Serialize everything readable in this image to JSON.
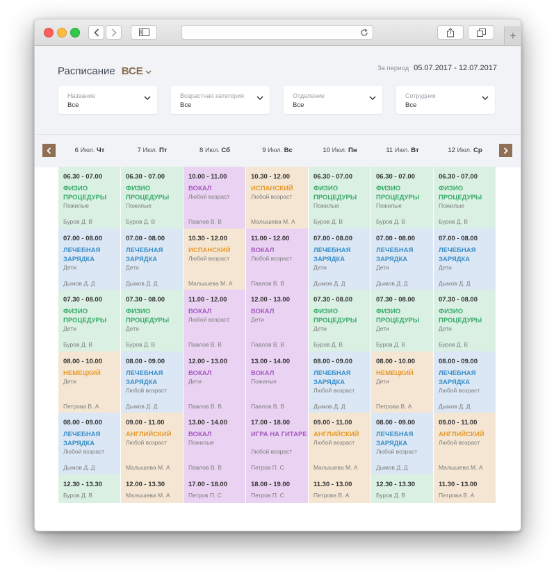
{
  "header": {
    "title": "Расписание",
    "selector": "ВСЕ",
    "period_label": "За период",
    "period_value": "05.07.2017 - 12.07.2017"
  },
  "filters": [
    {
      "label": "Название",
      "value": "Все"
    },
    {
      "label": "Возрастная категория",
      "value": "Все"
    },
    {
      "label": "Отделение",
      "value": "Все"
    },
    {
      "label": "Сотрудник",
      "value": "Все"
    }
  ],
  "colors": {
    "green": "#d9f0e3",
    "blue": "#dbe7f4",
    "pink": "#ead2f2",
    "orange": "#f5e6d3",
    "green_text": "#3aaa6a",
    "blue_text": "#3a8fc9",
    "pink_text": "#a55bc0",
    "orange_text": "#e69a2d",
    "accent": "#8f6f55"
  },
  "days": [
    {
      "num": "6",
      "mon": "Июл.",
      "wd": "Чт"
    },
    {
      "num": "7",
      "mon": "Июл.",
      "wd": "Пт"
    },
    {
      "num": "8",
      "mon": "Июл.",
      "wd": "Сб"
    },
    {
      "num": "9",
      "mon": "Июл.",
      "wd": "Вс"
    },
    {
      "num": "10",
      "mon": "Июл.",
      "wd": "Пн"
    },
    {
      "num": "11",
      "mon": "Июл.",
      "wd": "Вт"
    },
    {
      "num": "12",
      "mon": "Июл.",
      "wd": "Ср"
    }
  ],
  "schedule": [
    [
      {
        "time": "06.30 - 07.00",
        "name": "ФИЗИО ПРОЦЕДУРЫ",
        "age": "Пожилые",
        "teacher": "Буров Д. В",
        "color": "green"
      },
      {
        "time": "07.00 - 08.00",
        "name": "ЛЕЧЕБНАЯ ЗАРЯДКА",
        "age": "Дети",
        "teacher": "Дымов Д. Д",
        "color": "blue"
      },
      {
        "time": "07.30 - 08.00",
        "name": "ФИЗИО ПРОЦЕДУРЫ",
        "age": "Дети",
        "teacher": "Буров Д. В",
        "color": "green"
      },
      {
        "time": "08.00 - 10.00",
        "name": "НЕМЕЦКИЙ",
        "age": "Дети",
        "teacher": "Петрова В. А",
        "color": "orange"
      },
      {
        "time": "08.00 - 09.00",
        "name": "ЛЕЧЕБНАЯ ЗАРЯДКА",
        "age": "Любой возраст",
        "teacher": "Дымов Д. Д",
        "color": "blue"
      },
      {
        "time": "12.30 - 13.30",
        "name": "",
        "age": "",
        "teacher": "Буров Д. В",
        "color": "green"
      }
    ],
    [
      {
        "time": "06.30 - 07.00",
        "name": "ФИЗИО ПРОЦЕДУРЫ",
        "age": "Пожилые",
        "teacher": "Буров Д. В",
        "color": "green"
      },
      {
        "time": "07.00 - 08.00",
        "name": "ЛЕЧЕБНАЯ ЗАРЯДКА",
        "age": "Дети",
        "teacher": "Дымов Д. Д",
        "color": "blue"
      },
      {
        "time": "07.30 - 08.00",
        "name": "ФИЗИО ПРОЦЕДУРЫ",
        "age": "Дети",
        "teacher": "Буров Д. В",
        "color": "green"
      },
      {
        "time": "08.00 - 09.00",
        "name": "ЛЕЧЕБНАЯ ЗАРЯДКА",
        "age": "Любой возраст",
        "teacher": "Дымов Д. Д",
        "color": "blue"
      },
      {
        "time": "09.00 - 11.00",
        "name": "АНГЛИЙСКИЙ",
        "age": "Любой возраст",
        "teacher": "Малышева М. А",
        "color": "orange"
      },
      {
        "time": "12.00 - 13.30",
        "name": "",
        "age": "",
        "teacher": "Малышева М. А",
        "color": "orange"
      }
    ],
    [
      {
        "time": "10.00 - 11.00",
        "name": "ВОКАЛ",
        "age": "Любой возраст",
        "teacher": "Павлов В. В",
        "color": "pink"
      },
      {
        "time": "10.30 - 12.00",
        "name": "ИСПАНСКИЙ",
        "age": "Любой возраст",
        "teacher": "Малышева М. А",
        "color": "orange"
      },
      {
        "time": "11.00 - 12.00",
        "name": "ВОКАЛ",
        "age": "Любой возраст",
        "teacher": "Павлов В. В",
        "color": "pink"
      },
      {
        "time": "12.00 - 13.00",
        "name": "ВОКАЛ",
        "age": "Дети",
        "teacher": "Павлов В. В",
        "color": "pink"
      },
      {
        "time": "13.00 - 14.00",
        "name": "ВОКАЛ",
        "age": "Пожилые",
        "teacher": "Павлов В. В",
        "color": "pink"
      },
      {
        "time": "17.00 - 18.00",
        "name": "",
        "age": "",
        "teacher": "Петров П. С",
        "color": "pink"
      }
    ],
    [
      {
        "time": "10.30 - 12.00",
        "name": "ИСПАНСКИЙ",
        "age": "Любой возраст",
        "teacher": "Малышева М. А",
        "color": "orange"
      },
      {
        "time": "11.00 - 12.00",
        "name": "ВОКАЛ",
        "age": "Любой возраст",
        "teacher": "Павлов В. В",
        "color": "pink"
      },
      {
        "time": "12.00 - 13.00",
        "name": "ВОКАЛ",
        "age": "Дети",
        "teacher": "Павлов В. В",
        "color": "pink"
      },
      {
        "time": "13.00 - 14.00",
        "name": "ВОКАЛ",
        "age": "Пожилые",
        "teacher": "Павлов В. В",
        "color": "pink"
      },
      {
        "time": "17.00 - 18.00",
        "name": "ИГРА НА ГИТАРЕ",
        "age": "Любой возраст",
        "teacher": "Петров П. С",
        "color": "pink"
      },
      {
        "time": "18.00 - 19.00",
        "name": "",
        "age": "",
        "teacher": "Петров П. С",
        "color": "pink"
      }
    ],
    [
      {
        "time": "06.30 - 07.00",
        "name": "ФИЗИО ПРОЦЕДУРЫ",
        "age": "Пожилые",
        "teacher": "Буров Д. В",
        "color": "green"
      },
      {
        "time": "07.00 - 08.00",
        "name": "ЛЕЧЕБНАЯ ЗАРЯДКА",
        "age": "Дети",
        "teacher": "Дымов Д. Д",
        "color": "blue"
      },
      {
        "time": "07.30 - 08.00",
        "name": "ФИЗИО ПРОЦЕДУРЫ",
        "age": "Дети",
        "teacher": "Буров Д. В",
        "color": "green"
      },
      {
        "time": "08.00 - 09.00",
        "name": "ЛЕЧЕБНАЯ ЗАРЯДКА",
        "age": "Любой возраст",
        "teacher": "Дымов Д. Д",
        "color": "blue"
      },
      {
        "time": "09.00 - 11.00",
        "name": "АНГЛИЙСКИЙ",
        "age": "Любой возраст",
        "teacher": "Малышева М. А",
        "color": "orange"
      },
      {
        "time": "11.30 - 13.00",
        "name": "",
        "age": "",
        "teacher": "Петрова В. А",
        "color": "orange"
      }
    ],
    [
      {
        "time": "06.30 - 07.00",
        "name": "ФИЗИО ПРОЦЕДУРЫ",
        "age": "Пожилые",
        "teacher": "Буров Д. В",
        "color": "green"
      },
      {
        "time": "07.00 - 08.00",
        "name": "ЛЕЧЕБНАЯ ЗАРЯДКА",
        "age": "Дети",
        "teacher": "Дымов Д. Д",
        "color": "blue"
      },
      {
        "time": "07.30 - 08.00",
        "name": "ФИЗИО ПРОЦЕДУРЫ",
        "age": "Дети",
        "teacher": "Буров Д. В",
        "color": "green"
      },
      {
        "time": "08.00 - 10.00",
        "name": "НЕМЕЦКИЙ",
        "age": "Дети",
        "teacher": "Петрова В. А",
        "color": "orange"
      },
      {
        "time": "08.00 - 09.00",
        "name": "ЛЕЧЕБНАЯ ЗАРЯДКА",
        "age": "Любой возраст",
        "teacher": "Дымов Д. Д",
        "color": "blue"
      },
      {
        "time": "12.30 - 13.30",
        "name": "",
        "age": "",
        "teacher": "Буров Д. В",
        "color": "green"
      }
    ],
    [
      {
        "time": "06.30 - 07.00",
        "name": "ФИЗИО ПРОЦЕДУРЫ",
        "age": "Пожилые",
        "teacher": "Буров Д. В",
        "color": "green"
      },
      {
        "time": "07.00 - 08.00",
        "name": "ЛЕЧЕБНАЯ ЗАРЯДКА",
        "age": "Дети",
        "teacher": "Дымов Д. Д",
        "color": "blue"
      },
      {
        "time": "07.30 - 08.00",
        "name": "ФИЗИО ПРОЦЕДУРЫ",
        "age": "Дети",
        "teacher": "Буров Д. В",
        "color": "green"
      },
      {
        "time": "08.00 - 09.00",
        "name": "ЛЕЧЕБНАЯ ЗАРЯДКА",
        "age": "Любой возраст",
        "teacher": "Дымов Д. Д",
        "color": "blue"
      },
      {
        "time": "09.00 - 11.00",
        "name": "АНГЛИЙСКИЙ",
        "age": "Любой возраст",
        "teacher": "Малышева М. А",
        "color": "orange"
      },
      {
        "time": "11.30 - 13.00",
        "name": "",
        "age": "",
        "teacher": "Петрова В. А",
        "color": "orange"
      }
    ]
  ]
}
